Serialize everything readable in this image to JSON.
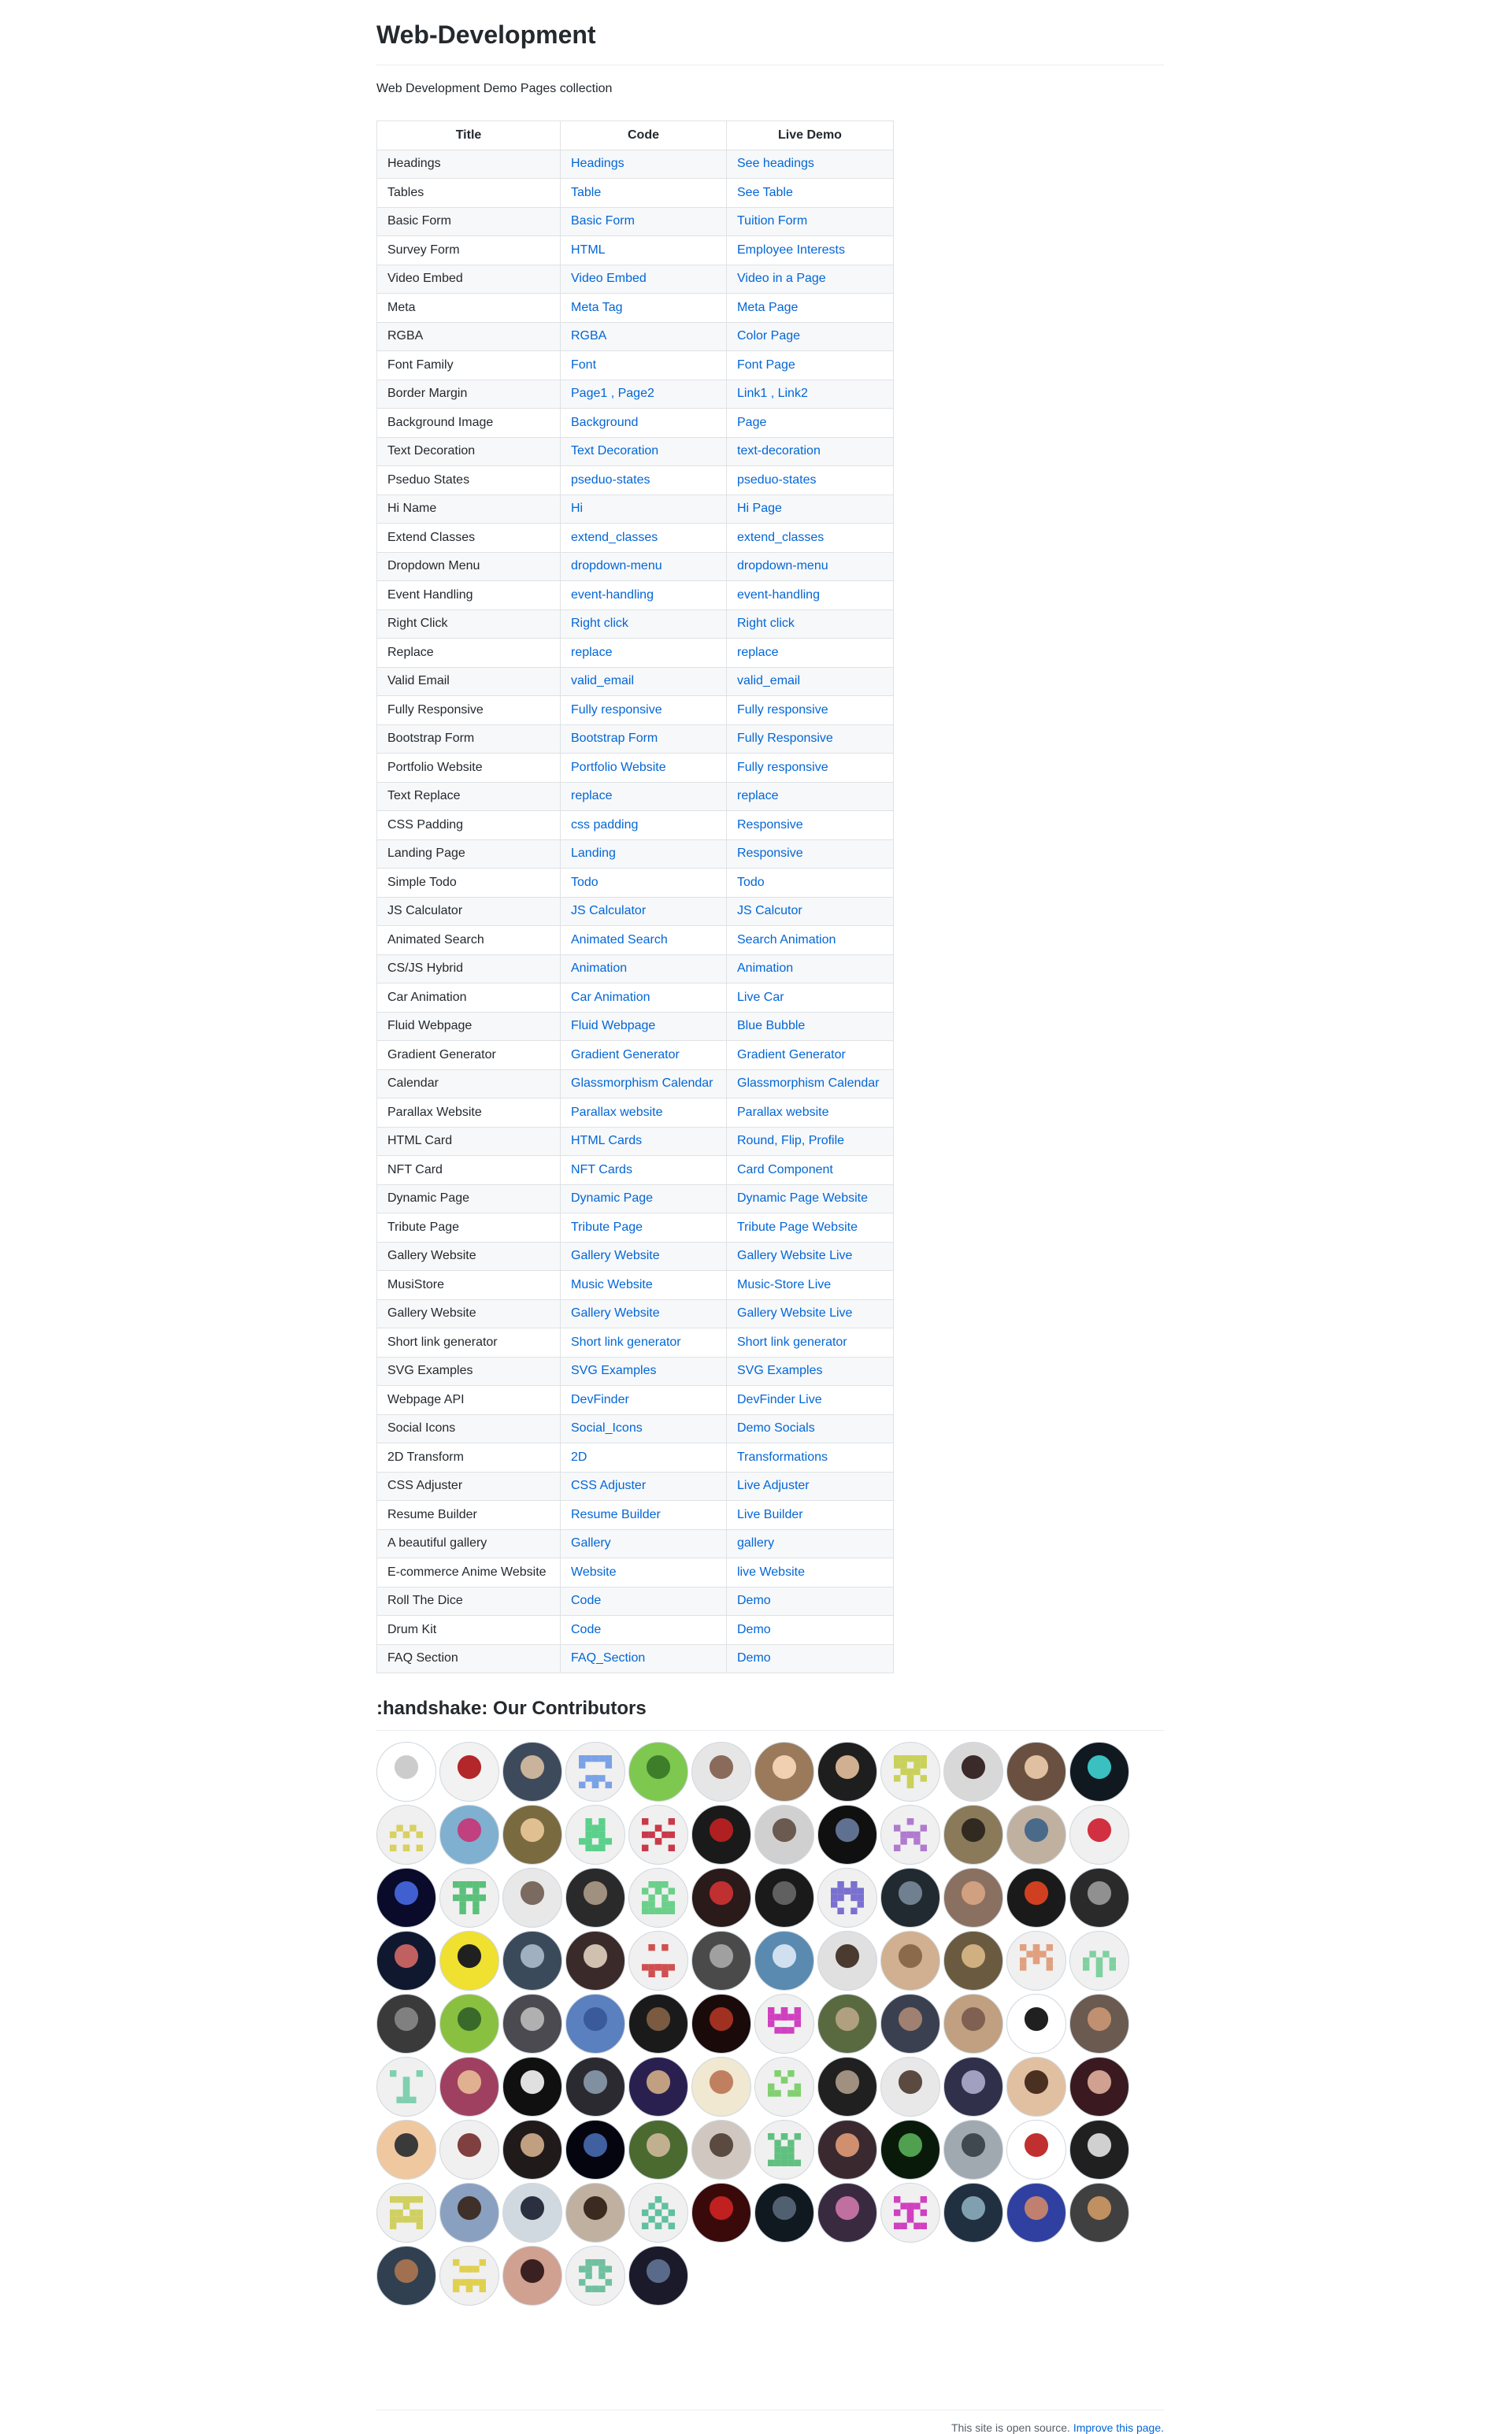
{
  "title": "Web-Development",
  "description": "Web Development Demo Pages collection",
  "table": {
    "headers": [
      "Title",
      "Code",
      "Live Demo"
    ],
    "rows": [
      {
        "title": "Headings",
        "code": "Headings",
        "demo": "See headings"
      },
      {
        "title": "Tables",
        "code": "Table",
        "demo": "See Table"
      },
      {
        "title": "Basic Form",
        "code": "Basic Form",
        "demo": "Tuition Form"
      },
      {
        "title": "Survey Form",
        "code": "HTML",
        "demo": "Employee Interests"
      },
      {
        "title": "Video Embed",
        "code": "Video Embed",
        "demo": "Video in a Page"
      },
      {
        "title": "Meta",
        "code": "Meta Tag",
        "demo": "Meta Page"
      },
      {
        "title": "RGBA",
        "code": "RGBA",
        "demo": "Color Page"
      },
      {
        "title": "Font Family",
        "code": "Font",
        "demo": "Font Page"
      },
      {
        "title": "Border Margin",
        "code": "Page1 , Page2",
        "demo": "Link1 , Link2"
      },
      {
        "title": "Background Image",
        "code": "Background",
        "demo": "Page"
      },
      {
        "title": "Text Decoration",
        "code": "Text Decoration",
        "demo": "text-decoration"
      },
      {
        "title": "Pseduo States",
        "code": "pseduo-states",
        "demo": "pseduo-states"
      },
      {
        "title": "Hi Name",
        "code": "Hi",
        "demo": "Hi Page"
      },
      {
        "title": "Extend Classes",
        "code": "extend_classes",
        "demo": "extend_classes"
      },
      {
        "title": "Dropdown Menu",
        "code": "dropdown-menu",
        "demo": "dropdown-menu"
      },
      {
        "title": "Event Handling",
        "code": "event-handling",
        "demo": "event-handling"
      },
      {
        "title": "Right Click",
        "code": "Right click",
        "demo": "Right click"
      },
      {
        "title": "Replace",
        "code": "replace",
        "demo": "replace"
      },
      {
        "title": "Valid Email",
        "code": "valid_email",
        "demo": "valid_email"
      },
      {
        "title": "Fully Responsive",
        "code": "Fully responsive",
        "demo": "Fully responsive"
      },
      {
        "title": "Bootstrap Form",
        "code": "Bootstrap Form",
        "demo": "Fully Responsive"
      },
      {
        "title": "Portfolio Website",
        "code": "Portfolio Website",
        "demo": "Fully responsive"
      },
      {
        "title": "Text Replace",
        "code": "replace",
        "demo": "replace"
      },
      {
        "title": "CSS Padding",
        "code": "css padding",
        "demo": "Responsive"
      },
      {
        "title": "Landing Page",
        "code": "Landing",
        "demo": "Responsive"
      },
      {
        "title": "Simple Todo",
        "code": "Todo",
        "demo": "Todo"
      },
      {
        "title": "JS Calculator",
        "code": "JS Calculator",
        "demo": "JS Calcutor"
      },
      {
        "title": "Animated Search",
        "code": "Animated Search",
        "demo": "Search Animation"
      },
      {
        "title": "CS/JS Hybrid",
        "code": "Animation",
        "demo": "Animation"
      },
      {
        "title": "Car Animation",
        "code": "Car Animation",
        "demo": "Live Car"
      },
      {
        "title": "Fluid Webpage",
        "code": "Fluid Webpage",
        "demo": "Blue Bubble"
      },
      {
        "title": "Gradient Generator",
        "code": "Gradient Generator",
        "demo": "Gradient Generator"
      },
      {
        "title": "Calendar",
        "code": "Glassmorphism Calendar",
        "demo": "Glassmorphism Calendar"
      },
      {
        "title": "Parallax Website",
        "code": "Parallax website",
        "demo": "Parallax website"
      },
      {
        "title": "HTML Card",
        "code": "HTML Cards",
        "demo": "Round, Flip, Profile"
      },
      {
        "title": "NFT Card",
        "code": "NFT Cards",
        "demo": "Card Component"
      },
      {
        "title": "Dynamic Page",
        "code": "Dynamic Page",
        "demo": "Dynamic Page Website"
      },
      {
        "title": "Tribute Page",
        "code": "Tribute Page",
        "demo": "Tribute Page Website"
      },
      {
        "title": "Gallery Website",
        "code": "Gallery Website",
        "demo": "Gallery Website Live"
      },
      {
        "title": "MusiStore",
        "code": "Music Website",
        "demo": "Music-Store Live"
      },
      {
        "title": "Gallery Website",
        "code": "Gallery Website",
        "demo": "Gallery Website Live"
      },
      {
        "title": "Short link generator",
        "code": "Short link generator",
        "demo": "Short link generator"
      },
      {
        "title": "SVG Examples",
        "code": "SVG Examples",
        "demo": "SVG Examples"
      },
      {
        "title": "Webpage API",
        "code": "DevFinder",
        "demo": "DevFinder Live"
      },
      {
        "title": "Social Icons",
        "code": "Social_Icons",
        "demo": "Demo Socials"
      },
      {
        "title": "2D Transform",
        "code": "2D",
        "demo": "Transformations"
      },
      {
        "title": "CSS Adjuster",
        "code": "CSS Adjuster",
        "demo": "Live Adjuster"
      },
      {
        "title": "Resume Builder",
        "code": "Resume Builder",
        "demo": "Live Builder"
      },
      {
        "title": "A beautiful gallery",
        "code": "Gallery",
        "demo": "gallery"
      },
      {
        "title": "E-commerce Anime Website",
        "code": "Website",
        "demo": "live Website"
      },
      {
        "title": "Roll The Dice",
        "code": "Code",
        "demo": "Demo"
      },
      {
        "title": "Drum Kit",
        "code": "Code",
        "demo": "Demo"
      },
      {
        "title": "FAQ Section",
        "code": "FAQ_Section",
        "demo": "Demo"
      }
    ]
  },
  "contributors_heading": ":handshake: Our Contributors",
  "contributors": [
    {
      "bg": "#ffffff",
      "fg": "#cccccc",
      "type": "photo"
    },
    {
      "bg": "#f2f2f2",
      "fg": "#b3262a",
      "type": "photo"
    },
    {
      "bg": "#3d4a5c",
      "fg": "#c9b39a",
      "type": "photo"
    },
    {
      "bg": "#f0f0f0",
      "fg": "#7aa2e6",
      "type": "identicon"
    },
    {
      "bg": "#7ec850",
      "fg": "#3e7d2a",
      "type": "photo"
    },
    {
      "bg": "#e6e6e6",
      "fg": "#8a6a5a",
      "type": "photo"
    },
    {
      "bg": "#9a7a5a",
      "fg": "#f0d0b0",
      "type": "photo"
    },
    {
      "bg": "#1e1e1e",
      "fg": "#d0b090",
      "type": "photo"
    },
    {
      "bg": "#f0f0f0",
      "fg": "#c9d15a",
      "type": "identicon"
    },
    {
      "bg": "#d8d8d8",
      "fg": "#3a2a2a",
      "type": "photo"
    },
    {
      "bg": "#6a5040",
      "fg": "#e0c0a0",
      "type": "photo"
    },
    {
      "bg": "#101820",
      "fg": "#3ac0c0",
      "type": "photo"
    },
    {
      "bg": "#f0f0f0",
      "fg": "#d8d060",
      "type": "identicon"
    },
    {
      "bg": "#7fb0d0",
      "fg": "#c04080",
      "type": "photo"
    },
    {
      "bg": "#7a6a40",
      "fg": "#e0c090",
      "type": "photo"
    },
    {
      "bg": "#f0f0f0",
      "fg": "#5ad08a",
      "type": "identicon"
    },
    {
      "bg": "#f0f0f0",
      "fg": "#c83a4a",
      "type": "identicon"
    },
    {
      "bg": "#1a1a1a",
      "fg": "#b02020",
      "type": "photo"
    },
    {
      "bg": "#d0d0d0",
      "fg": "#6a5a50",
      "type": "photo"
    },
    {
      "bg": "#101010",
      "fg": "#607090",
      "type": "photo"
    },
    {
      "bg": "#f0f0f0",
      "fg": "#b07ad0",
      "type": "identicon"
    },
    {
      "bg": "#8a7a5a",
      "fg": "#302a20",
      "type": "photo"
    },
    {
      "bg": "#c0b0a0",
      "fg": "#4a6a8a",
      "type": "photo"
    },
    {
      "bg": "#f0f0f0",
      "fg": "#d03040",
      "type": "photo"
    },
    {
      "bg": "#0a0a2a",
      "fg": "#4060d0",
      "type": "photo"
    },
    {
      "bg": "#f0f0f0",
      "fg": "#5ac07a",
      "type": "identicon"
    },
    {
      "bg": "#e8e8e8",
      "fg": "#7a6a60",
      "type": "photo"
    },
    {
      "bg": "#2a2a2a",
      "fg": "#a09080",
      "type": "photo"
    },
    {
      "bg": "#f0f0f0",
      "fg": "#6ad08a",
      "type": "identicon"
    },
    {
      "bg": "#2a1a1a",
      "fg": "#c03030",
      "type": "photo"
    },
    {
      "bg": "#1a1a1a",
      "fg": "#606060",
      "type": "photo"
    },
    {
      "bg": "#f0f0f0",
      "fg": "#7a70d0",
      "type": "identicon"
    },
    {
      "bg": "#202a30",
      "fg": "#708090",
      "type": "photo"
    },
    {
      "bg": "#8a7060",
      "fg": "#d0a080",
      "type": "photo"
    },
    {
      "bg": "#1a1a1a",
      "fg": "#d04020",
      "type": "photo"
    },
    {
      "bg": "#2a2a2a",
      "fg": "#909090",
      "type": "photo"
    },
    {
      "bg": "#101830",
      "fg": "#c06060",
      "type": "photo"
    },
    {
      "bg": "#f0e030",
      "fg": "#202020",
      "type": "photo"
    },
    {
      "bg": "#3a4a5a",
      "fg": "#a0b0c0",
      "type": "photo"
    },
    {
      "bg": "#3a2a2a",
      "fg": "#d0c0b0",
      "type": "photo"
    },
    {
      "bg": "#f0f0f0",
      "fg": "#d05050",
      "type": "identicon"
    },
    {
      "bg": "#4a4a4a",
      "fg": "#a0a0a0",
      "type": "photo"
    },
    {
      "bg": "#5a8ab0",
      "fg": "#d0e0f0",
      "type": "photo"
    },
    {
      "bg": "#e0e0e0",
      "fg": "#4a3a30",
      "type": "photo"
    },
    {
      "bg": "#d0b090",
      "fg": "#8a6a4a",
      "type": "photo"
    },
    {
      "bg": "#6a5a40",
      "fg": "#d0b080",
      "type": "photo"
    },
    {
      "bg": "#f0f0f0",
      "fg": "#e0a080",
      "type": "identicon"
    },
    {
      "bg": "#f0f0f0",
      "fg": "#80d0a0",
      "type": "identicon"
    },
    {
      "bg": "#3a3a3a",
      "fg": "#808080",
      "type": "photo"
    },
    {
      "bg": "#8ac040",
      "fg": "#3a6a2a",
      "type": "photo"
    },
    {
      "bg": "#4a4a50",
      "fg": "#b0b0b0",
      "type": "photo"
    },
    {
      "bg": "#5a80c0",
      "fg": "#3a5a9a",
      "type": "photo"
    },
    {
      "bg": "#1a1a1a",
      "fg": "#7a5a40",
      "type": "photo"
    },
    {
      "bg": "#1a0a0a",
      "fg": "#a03020",
      "type": "photo"
    },
    {
      "bg": "#f0f0f0",
      "fg": "#d040c0",
      "type": "identicon"
    },
    {
      "bg": "#5a6a40",
      "fg": "#b0a080",
      "type": "photo"
    },
    {
      "bg": "#3a4050",
      "fg": "#a08070",
      "type": "photo"
    },
    {
      "bg": "#c0a080",
      "fg": "#806050",
      "type": "photo"
    },
    {
      "bg": "#ffffff",
      "fg": "#202020",
      "type": "photo"
    },
    {
      "bg": "#6a5a50",
      "fg": "#c09070",
      "type": "photo"
    },
    {
      "bg": "#f0f0f0",
      "fg": "#80d0b0",
      "type": "identicon"
    },
    {
      "bg": "#a04060",
      "fg": "#e0b090",
      "type": "photo"
    },
    {
      "bg": "#101010",
      "fg": "#e0e0e0",
      "type": "photo"
    },
    {
      "bg": "#2a2a30",
      "fg": "#8090a0",
      "type": "photo"
    },
    {
      "bg": "#2a2050",
      "fg": "#c0a080",
      "type": "photo"
    },
    {
      "bg": "#f0e8d0",
      "fg": "#c08060",
      "type": "photo"
    },
    {
      "bg": "#f0f0f0",
      "fg": "#80d070",
      "type": "identicon"
    },
    {
      "bg": "#202020",
      "fg": "#a09080",
      "type": "photo"
    },
    {
      "bg": "#e8e8e8",
      "fg": "#5a4a40",
      "type": "photo"
    },
    {
      "bg": "#30304a",
      "fg": "#a0a0c0",
      "type": "photo"
    },
    {
      "bg": "#e0c0a0",
      "fg": "#4a3020",
      "type": "photo"
    },
    {
      "bg": "#3a1a20",
      "fg": "#d0a090",
      "type": "photo"
    },
    {
      "bg": "#f0c8a0",
      "fg": "#3a3a3a",
      "type": "photo"
    },
    {
      "bg": "#f0f0f0",
      "fg": "#804040",
      "type": "photo"
    },
    {
      "bg": "#201a1a",
      "fg": "#c0a080",
      "type": "photo"
    },
    {
      "bg": "#050510",
      "fg": "#4060a0",
      "type": "photo"
    },
    {
      "bg": "#4a6a30",
      "fg": "#c0b090",
      "type": "photo"
    },
    {
      "bg": "#d0c8c0",
      "fg": "#5a4a40",
      "type": "photo"
    },
    {
      "bg": "#f0f0f0",
      "fg": "#60c080",
      "type": "identicon"
    },
    {
      "bg": "#3a2a30",
      "fg": "#d09070",
      "type": "photo"
    },
    {
      "bg": "#0a1a0a",
      "fg": "#50a050",
      "type": "photo"
    },
    {
      "bg": "#a0a8b0",
      "fg": "#404850",
      "type": "photo"
    },
    {
      "bg": "#ffffff",
      "fg": "#c03030",
      "type": "photo"
    },
    {
      "bg": "#202020",
      "fg": "#d0d0d0",
      "type": "photo"
    },
    {
      "bg": "#f0f0f0",
      "fg": "#d0d060",
      "type": "identicon"
    },
    {
      "bg": "#8aa0c0",
      "fg": "#40302a",
      "type": "photo"
    },
    {
      "bg": "#d0d8e0",
      "fg": "#2a3040",
      "type": "photo"
    },
    {
      "bg": "#c0b0a0",
      "fg": "#3a2a20",
      "type": "photo"
    },
    {
      "bg": "#f0f0f0",
      "fg": "#60c0a0",
      "type": "identicon"
    },
    {
      "bg": "#3a0a0a",
      "fg": "#c02020",
      "type": "photo"
    },
    {
      "bg": "#101820",
      "fg": "#506070",
      "type": "photo"
    },
    {
      "bg": "#3a2a40",
      "fg": "#c070a0",
      "type": "photo"
    },
    {
      "bg": "#f0f0f0",
      "fg": "#d040c0",
      "type": "identicon"
    },
    {
      "bg": "#203040",
      "fg": "#80a0b0",
      "type": "photo"
    },
    {
      "bg": "#3040a0",
      "fg": "#c08070",
      "type": "photo"
    },
    {
      "bg": "#404040",
      "fg": "#c09060",
      "type": "photo"
    },
    {
      "bg": "#304050",
      "fg": "#a07050",
      "type": "photo"
    },
    {
      "bg": "#f0f0f0",
      "fg": "#e0d050",
      "type": "identicon"
    },
    {
      "bg": "#d0a090",
      "fg": "#3a2020",
      "type": "photo"
    },
    {
      "bg": "#f0f0f0",
      "fg": "#70c0a0",
      "type": "identicon"
    },
    {
      "bg": "#1a1a2a",
      "fg": "#5a6a8a",
      "type": "photo"
    }
  ],
  "footer": {
    "text": "This site is open source.",
    "link": "Improve this page."
  }
}
